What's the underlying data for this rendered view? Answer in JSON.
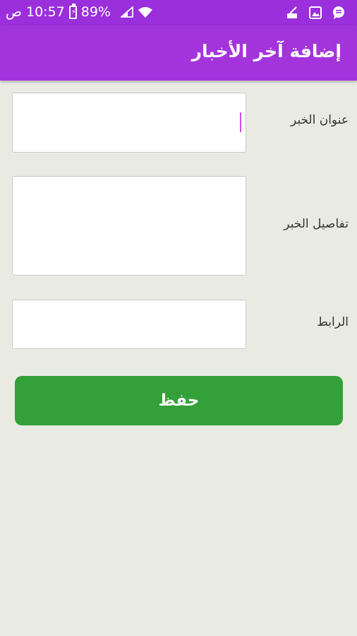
{
  "status_bar": {
    "time": "10:57",
    "ampm": "ص",
    "battery": "89%",
    "icons": [
      "chat-icon",
      "image-icon",
      "broom-icon",
      "wifi-icon",
      "signal-icon",
      "battery-icon"
    ]
  },
  "app_bar": {
    "title": "إضافة آخر الأخبار"
  },
  "form": {
    "title_label": "عنوان الخبر",
    "details_label": "تفاصيل الخبر",
    "link_label": "الرابط",
    "title_value": "",
    "details_value": "",
    "link_value": ""
  },
  "actions": {
    "save_label": "حفظ"
  },
  "colors": {
    "status_bar": "#9a2fdb",
    "app_bar": "#a334dc",
    "save_button": "#33a03a",
    "background": "#e9ebe3"
  }
}
